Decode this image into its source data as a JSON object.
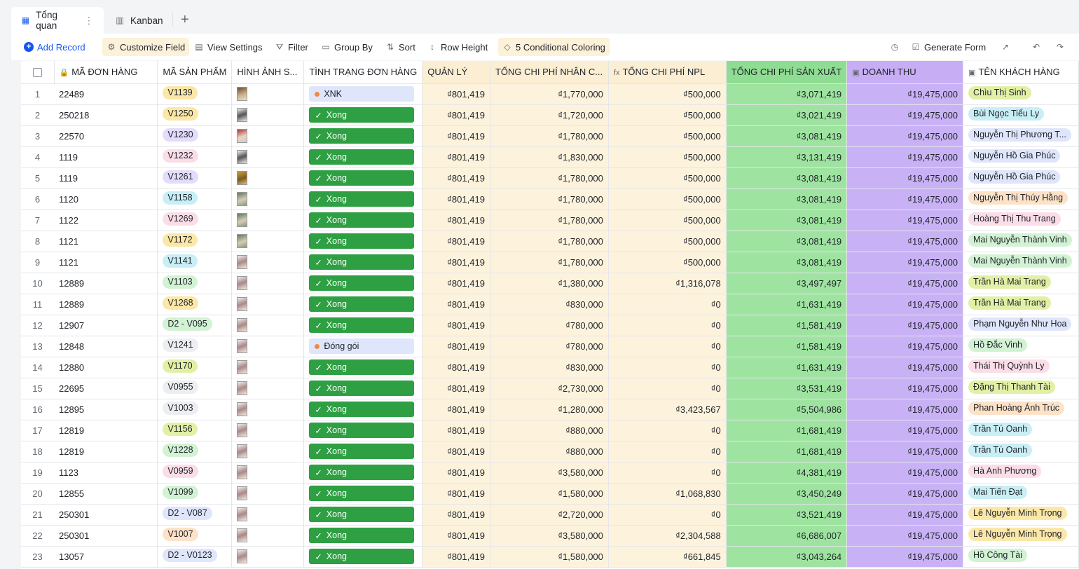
{
  "tabs": [
    {
      "label": "Tổng quan"
    },
    {
      "label": "Kanban"
    }
  ],
  "toolbar": {
    "add_record": "Add Record",
    "customize_field": "Customize Field",
    "view_settings": "View Settings",
    "filter": "Filter",
    "group_by": "Group By",
    "sort": "Sort",
    "row_height": "Row Height",
    "conditional_coloring": "5 Conditional Coloring",
    "generate_form": "Generate Form"
  },
  "columns": [
    "MÃ ĐƠN HÀNG",
    "MÃ SẢN PHẨM",
    "HÌNH ẢNH S...",
    "TÌNH TRẠNG ĐƠN HÀNG",
    "QUẢN LÝ",
    "TỔNG CHI PHÍ NHÂN C...",
    "TỔNG CHI PHÍ NPL",
    "TỔNG CHI PHÍ SẢN XUẤT",
    "DOANH THU",
    "TÊN KHÁCH HÀNG"
  ],
  "colors": {
    "accent": "#1456f0",
    "done": "#2ea043",
    "green_col": "#9fe3a1",
    "purple_col": "#c8b2f5",
    "yellow_col": "#fdf3dd"
  },
  "rows": [
    {
      "idx": "1",
      "order": "22489",
      "sku": "V1139",
      "sku_color": "#fbe7a8",
      "img": "t1",
      "status": "XNK",
      "done": false,
      "ql": "₫801,419",
      "nc": "₫1,770,000",
      "npl": "₫500,000",
      "sx": "₫3,071,419",
      "dt": "₫19,475,000",
      "kh": "Chìu Thị Sinh",
      "kh_color": "#e2f0a6"
    },
    {
      "idx": "2",
      "order": "250218",
      "sku": "V1250",
      "sku_color": "#fbe7a8",
      "img": "t2",
      "status": "Xong",
      "done": true,
      "ql": "₫801,419",
      "nc": "₫1,720,000",
      "npl": "₫500,000",
      "sx": "₫3,021,419",
      "dt": "₫19,475,000",
      "kh": "Bùi Ngọc Tiểu Ly",
      "kh_color": "#c9eef5"
    },
    {
      "idx": "3",
      "order": "22570",
      "sku": "V1230",
      "sku_color": "#e4dcfb",
      "img": "t3",
      "status": "Xong",
      "done": true,
      "ql": "₫801,419",
      "nc": "₫1,780,000",
      "npl": "₫500,000",
      "sx": "₫3,081,419",
      "dt": "₫19,475,000",
      "kh": "Nguyễn Thị Phương T...",
      "kh_color": "#dfe6fb"
    },
    {
      "idx": "4",
      "order": "1119",
      "sku": "V1232",
      "sku_color": "#fbdde8",
      "img": "t2",
      "status": "Xong",
      "done": true,
      "ql": "₫801,419",
      "nc": "₫1,830,000",
      "npl": "₫500,000",
      "sx": "₫3,131,419",
      "dt": "₫19,475,000",
      "kh": "Nguyễn Hồ Gia Phúc",
      "kh_color": "#dfe6fb"
    },
    {
      "idx": "5",
      "order": "1119",
      "sku": "V1261",
      "sku_color": "#e4dcfb",
      "img": "t4",
      "status": "Xong",
      "done": true,
      "ql": "₫801,419",
      "nc": "₫1,780,000",
      "npl": "₫500,000",
      "sx": "₫3,081,419",
      "dt": "₫19,475,000",
      "kh": "Nguyễn Hồ Gia Phúc",
      "kh_color": "#dfe6fb"
    },
    {
      "idx": "6",
      "order": "1120",
      "sku": "V1158",
      "sku_color": "#c9eef5",
      "img": "t5",
      "status": "Xong",
      "done": true,
      "ql": "₫801,419",
      "nc": "₫1,780,000",
      "npl": "₫500,000",
      "sx": "₫3,081,419",
      "dt": "₫19,475,000",
      "kh": "Nguyễn Thị Thúy Hằng",
      "kh_color": "#fde2c8"
    },
    {
      "idx": "7",
      "order": "1122",
      "sku": "V1269",
      "sku_color": "#fbdde8",
      "img": "t5",
      "status": "Xong",
      "done": true,
      "ql": "₫801,419",
      "nc": "₫1,780,000",
      "npl": "₫500,000",
      "sx": "₫3,081,419",
      "dt": "₫19,475,000",
      "kh": "Hoàng Thị Thu Trang",
      "kh_color": "#fbdde8"
    },
    {
      "idx": "8",
      "order": "1121",
      "sku": "V1172",
      "sku_color": "#fbe7a8",
      "img": "t5",
      "status": "Xong",
      "done": true,
      "ql": "₫801,419",
      "nc": "₫1,780,000",
      "npl": "₫500,000",
      "sx": "₫3,081,419",
      "dt": "₫19,475,000",
      "kh": "Mai Nguyễn Thành Vinh",
      "kh_color": "#d2f2d4"
    },
    {
      "idx": "9",
      "order": "1121",
      "sku": "V1141",
      "sku_color": "#c9eef5",
      "img": "t6",
      "status": "Xong",
      "done": true,
      "ql": "₫801,419",
      "nc": "₫1,780,000",
      "npl": "₫500,000",
      "sx": "₫3,081,419",
      "dt": "₫19,475,000",
      "kh": "Mai Nguyễn Thành Vinh",
      "kh_color": "#d2f2d4"
    },
    {
      "idx": "10",
      "order": "12889",
      "sku": "V1103",
      "sku_color": "#d2f2d4",
      "img": "t6",
      "status": "Xong",
      "done": true,
      "ql": "₫801,419",
      "nc": "₫1,380,000",
      "npl": "₫1,316,078",
      "sx": "₫3,497,497",
      "dt": "₫19,475,000",
      "kh": "Trần Hà Mai Trang",
      "kh_color": "#e2f0a6"
    },
    {
      "idx": "11",
      "order": "12889",
      "sku": "V1268",
      "sku_color": "#fbe7a8",
      "img": "t6",
      "status": "Xong",
      "done": true,
      "ql": "₫801,419",
      "nc": "₫830,000",
      "npl": "₫0",
      "sx": "₫1,631,419",
      "dt": "₫19,475,000",
      "kh": "Trần Hà Mai Trang",
      "kh_color": "#e2f0a6"
    },
    {
      "idx": "12",
      "order": "12907",
      "sku": "D2 - V095",
      "sku_color": "#d2f2d4",
      "img": "t6",
      "status": "Xong",
      "done": true,
      "ql": "₫801,419",
      "nc": "₫780,000",
      "npl": "₫0",
      "sx": "₫1,581,419",
      "dt": "₫19,475,000",
      "kh": "Phạm Nguyễn Như Hoa",
      "kh_color": "#dfe6fb"
    },
    {
      "idx": "13",
      "order": "12848",
      "sku": "V1241",
      "sku_color": "#eceef1",
      "img": "t6",
      "status": "Đóng gói",
      "done": false,
      "ql": "₫801,419",
      "nc": "₫780,000",
      "npl": "₫0",
      "sx": "₫1,581,419",
      "dt": "₫19,475,000",
      "kh": "Hồ Đắc Vinh",
      "kh_color": "#d2f2d4"
    },
    {
      "idx": "14",
      "order": "12880",
      "sku": "V1170",
      "sku_color": "#e2f0a6",
      "img": "t6",
      "status": "Xong",
      "done": true,
      "ql": "₫801,419",
      "nc": "₫830,000",
      "npl": "₫0",
      "sx": "₫1,631,419",
      "dt": "₫19,475,000",
      "kh": "Thái Thị Quỳnh Ly",
      "kh_color": "#fbdde8"
    },
    {
      "idx": "15",
      "order": "22695",
      "sku": "V0955",
      "sku_color": "#eceef1",
      "img": "t6",
      "status": "Xong",
      "done": true,
      "ql": "₫801,419",
      "nc": "₫2,730,000",
      "npl": "₫0",
      "sx": "₫3,531,419",
      "dt": "₫19,475,000",
      "kh": "Đặng Thị Thanh Tài",
      "kh_color": "#e2f0a6"
    },
    {
      "idx": "16",
      "order": "12895",
      "sku": "V1003",
      "sku_color": "#eceef1",
      "img": "t6",
      "status": "Xong",
      "done": true,
      "ql": "₫801,419",
      "nc": "₫1,280,000",
      "npl": "₫3,423,567",
      "sx": "₫5,504,986",
      "dt": "₫19,475,000",
      "kh": "Phan Hoàng Ánh Trúc",
      "kh_color": "#fde2c8"
    },
    {
      "idx": "17",
      "order": "12819",
      "sku": "V1156",
      "sku_color": "#e2f0a6",
      "img": "t6",
      "status": "Xong",
      "done": true,
      "ql": "₫801,419",
      "nc": "₫880,000",
      "npl": "₫0",
      "sx": "₫1,681,419",
      "dt": "₫19,475,000",
      "kh": "Trần Tú Oanh",
      "kh_color": "#c9eef5"
    },
    {
      "idx": "18",
      "order": "12819",
      "sku": "V1228",
      "sku_color": "#d2f2d4",
      "img": "t6",
      "status": "Xong",
      "done": true,
      "ql": "₫801,419",
      "nc": "₫880,000",
      "npl": "₫0",
      "sx": "₫1,681,419",
      "dt": "₫19,475,000",
      "kh": "Trần Tú Oanh",
      "kh_color": "#c9eef5"
    },
    {
      "idx": "19",
      "order": "1123",
      "sku": "V0959",
      "sku_color": "#fbdde8",
      "img": "t6",
      "status": "Xong",
      "done": true,
      "ql": "₫801,419",
      "nc": "₫3,580,000",
      "npl": "₫0",
      "sx": "₫4,381,419",
      "dt": "₫19,475,000",
      "kh": "Hà Anh Phương",
      "kh_color": "#fbdde8"
    },
    {
      "idx": "20",
      "order": "12855",
      "sku": "V1099",
      "sku_color": "#d2f2d4",
      "img": "t6",
      "status": "Xong",
      "done": true,
      "ql": "₫801,419",
      "nc": "₫1,580,000",
      "npl": "₫1,068,830",
      "sx": "₫3,450,249",
      "dt": "₫19,475,000",
      "kh": "Mai Tiến Đạt",
      "kh_color": "#c9eef5"
    },
    {
      "idx": "21",
      "order": "250301",
      "sku": "D2 - V087",
      "sku_color": "#dfe6fb",
      "img": "t6",
      "status": "Xong",
      "done": true,
      "ql": "₫801,419",
      "nc": "₫2,720,000",
      "npl": "₫0",
      "sx": "₫3,521,419",
      "dt": "₫19,475,000",
      "kh": "Lê Nguyễn Minh Trọng",
      "kh_color": "#fbe7a8"
    },
    {
      "idx": "22",
      "order": "250301",
      "sku": "V1007",
      "sku_color": "#fde2c8",
      "img": "t6",
      "status": "Xong",
      "done": true,
      "ql": "₫801,419",
      "nc": "₫3,580,000",
      "npl": "₫2,304,588",
      "sx": "₫6,686,007",
      "dt": "₫19,475,000",
      "kh": "Lê Nguyễn Minh Trọng",
      "kh_color": "#fbe7a8"
    },
    {
      "idx": "23",
      "order": "13057",
      "sku": "D2 - V0123",
      "sku_color": "#dfe6fb",
      "img": "t6",
      "status": "Xong",
      "done": true,
      "ql": "₫801,419",
      "nc": "₫1,580,000",
      "npl": "₫661,845",
      "sx": "₫3,043,264",
      "dt": "₫19,475,000",
      "kh": "Hồ Công Tài",
      "kh_color": "#d2f2d4"
    }
  ]
}
